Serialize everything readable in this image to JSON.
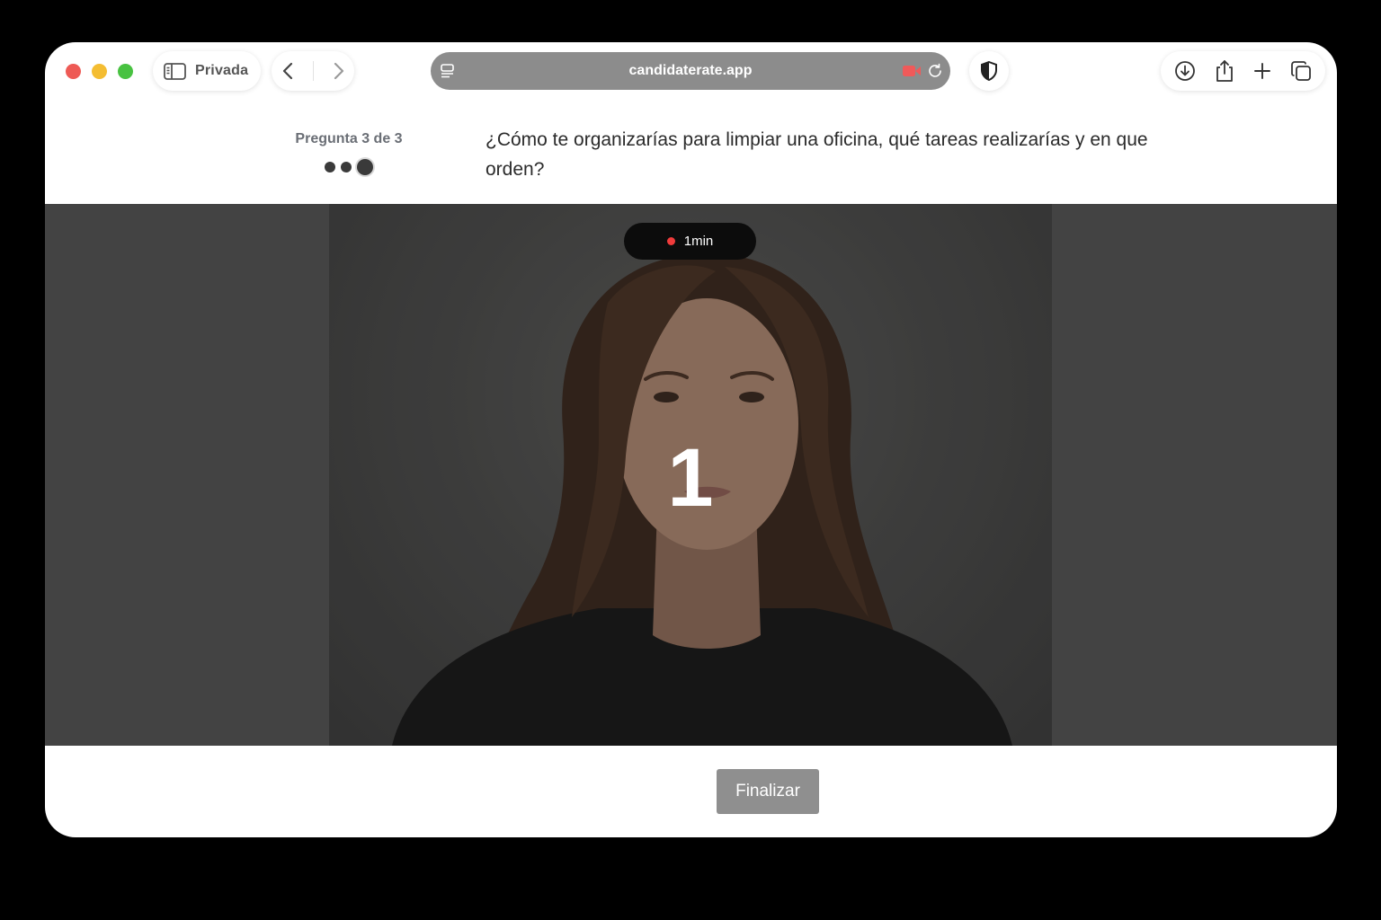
{
  "browser": {
    "private_label": "Privada",
    "url": "candidaterate.app"
  },
  "question": {
    "counter": "Pregunta 3 de 3",
    "total": 3,
    "current": 3,
    "text": "¿Cómo te organizarías para limpiar una oficina, qué tareas realizarías y en que orden?"
  },
  "recording": {
    "timer": "1min",
    "countdown": "1"
  },
  "footer": {
    "finish_label": "Finalizar"
  },
  "colors": {
    "rec_dot": "#f03b3b",
    "address_bar": "#8c8c8c",
    "finish_button": "#8f8f8f",
    "camera_indicator": "#f05a5a"
  }
}
